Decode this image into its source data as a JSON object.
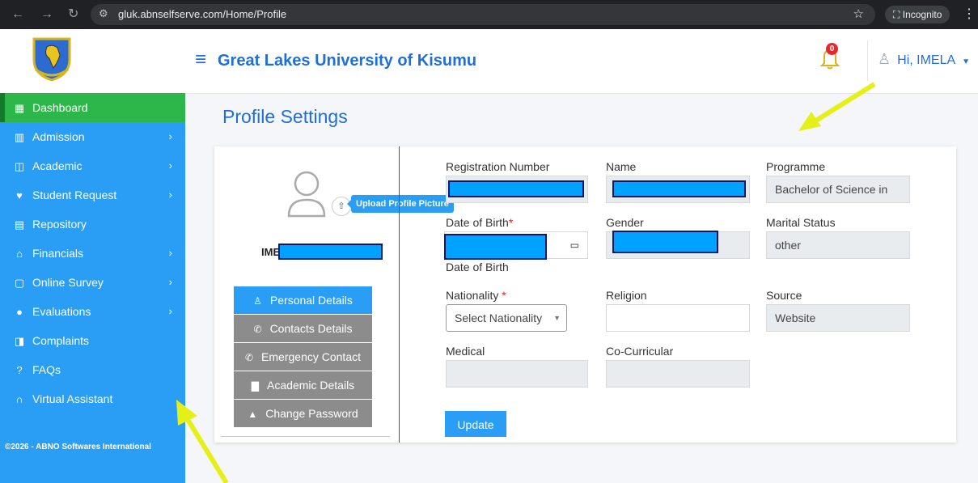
{
  "browser": {
    "url": "gluk.abnselfserve.com/Home/Profile",
    "incognito_label": "Incognito"
  },
  "header": {
    "title": "Great Lakes University of Kisumu",
    "notification_count": "0",
    "greeting": "Hi, IMELA"
  },
  "sidebar": {
    "items": [
      {
        "label": "Dashboard",
        "icon": "dashboard-icon",
        "glyph": "▦",
        "submenu": false,
        "active": true
      },
      {
        "label": "Admission",
        "icon": "admission-icon",
        "glyph": "▥",
        "submenu": true
      },
      {
        "label": "Academic",
        "icon": "book-icon",
        "glyph": "◫",
        "submenu": true
      },
      {
        "label": "Student Request",
        "icon": "heart-hand-icon",
        "glyph": "♥",
        "submenu": true
      },
      {
        "label": "Repository",
        "icon": "folder-icon",
        "glyph": "▤",
        "submenu": false
      },
      {
        "label": "Financials",
        "icon": "bank-icon",
        "glyph": "⌂",
        "submenu": true
      },
      {
        "label": "Online Survey",
        "icon": "clipboard-icon",
        "glyph": "▢",
        "submenu": true
      },
      {
        "label": "Evaluations",
        "icon": "question-circle-icon",
        "glyph": "●",
        "submenu": true
      },
      {
        "label": "Complaints",
        "icon": "complaint-icon",
        "glyph": "◨",
        "submenu": false
      },
      {
        "label": "FAQs",
        "icon": "faq-icon",
        "glyph": "?",
        "submenu": false
      },
      {
        "label": "Virtual Assistant",
        "icon": "headset-icon",
        "glyph": "∩",
        "submenu": false
      }
    ],
    "copyright": "©2026 - ABNO Softwares International"
  },
  "page": {
    "title": "Profile Settings"
  },
  "profile": {
    "name": "IMELA",
    "upload_tooltip": "Upload Profile Picture",
    "tabs": [
      {
        "label": "Personal Details",
        "icon": "person-icon",
        "glyph": "♙",
        "active": true
      },
      {
        "label": "Contacts Details",
        "icon": "phone-icon",
        "glyph": "✆"
      },
      {
        "label": "Emergency Contact",
        "icon": "phone-icon",
        "glyph": "✆"
      },
      {
        "label": "Academic Details",
        "icon": "file-icon",
        "glyph": "▇"
      },
      {
        "label": "Change Password",
        "icon": "lock-icon",
        "glyph": "▲"
      }
    ]
  },
  "form": {
    "registration_number_label": "Registration Number",
    "name_label": "Name",
    "programme_label": "Programme",
    "programme_value": "Bachelor of Science in",
    "dob_label": "Date of Birth",
    "dob_helper": "Date of Birth",
    "gender_label": "Gender",
    "marital_status_label": "Marital Status",
    "marital_status_value": "other",
    "nationality_label": "Nationality",
    "nationality_placeholder": "Select Nationality",
    "religion_label": "Religion",
    "religion_value": "",
    "source_label": "Source",
    "source_value": "Website",
    "medical_label": "Medical",
    "cocurricular_label": "Co-Curricular",
    "required_mark": "*",
    "update_label": "Update"
  },
  "colors": {
    "brand_blue": "#1f6fd9",
    "sidebar_blue": "#2a9df4",
    "active_green": "#2db74a",
    "annotation_arrow": "#e5f018",
    "redaction": "#00a2ff"
  }
}
